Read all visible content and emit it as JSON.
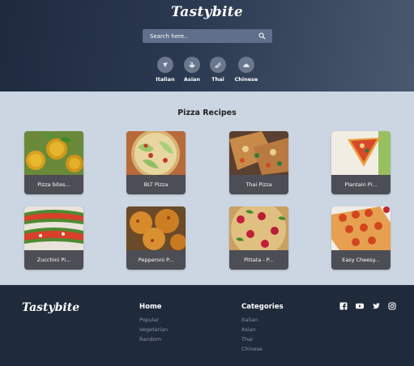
{
  "brand": {
    "logo": "Tastybite"
  },
  "search": {
    "placeholder": "Search here.."
  },
  "categories": [
    {
      "label": "Italian",
      "icon": "pizza-slice-icon"
    },
    {
      "label": "Asian",
      "icon": "noodle-bowl-icon"
    },
    {
      "label": "Thai",
      "icon": "chopsticks-icon"
    },
    {
      "label": "Chinese",
      "icon": "dumpling-icon"
    }
  ],
  "main": {
    "title": "Pizza Recipes",
    "recipes": [
      {
        "title": "Pizza bites..."
      },
      {
        "title": "BLT Pizza"
      },
      {
        "title": "Thai Pizza"
      },
      {
        "title": "Plantain Pi..."
      },
      {
        "title": "Zucchini Pi..."
      },
      {
        "title": "Pepperoni P..."
      },
      {
        "title": "Pittata - P..."
      },
      {
        "title": "Easy Cheesy..."
      }
    ]
  },
  "footer": {
    "logo": "Tastybite",
    "home": {
      "heading": "Home",
      "links": [
        "Popular",
        "Vegetarian",
        "Random"
      ]
    },
    "categories": {
      "heading": "Categories",
      "links": [
        "Italian",
        "Asian",
        "Thai",
        "Chinese"
      ]
    },
    "social": [
      "facebook-icon",
      "youtube-icon",
      "twitter-icon",
      "instagram-icon"
    ]
  },
  "colors": {
    "header_bg": "#1e2a3e",
    "page_bg": "#ccd6e2",
    "card_bg": "#4d4d55",
    "footer_bg": "#1f2a3b",
    "search_bg": "#5f6f8c"
  }
}
